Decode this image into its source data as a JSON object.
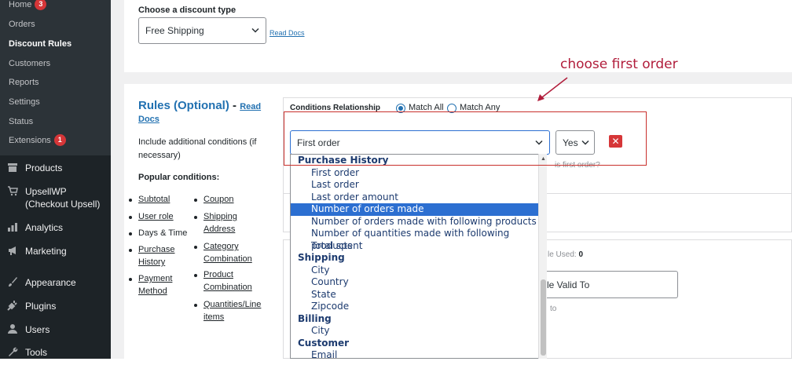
{
  "sidebar": {
    "submenu": [
      {
        "label": "Home",
        "badge": "3"
      },
      {
        "label": "Orders"
      },
      {
        "label": "Discount Rules"
      },
      {
        "label": "Customers"
      },
      {
        "label": "Reports"
      },
      {
        "label": "Settings"
      },
      {
        "label": "Status"
      },
      {
        "label": "Extensions",
        "badge": "1"
      }
    ],
    "menu": [
      {
        "label": "Products",
        "icon": "products-icon"
      },
      {
        "label": "UpsellWP\n(Checkout Upsell)",
        "icon": "cart-icon"
      },
      {
        "label": "Analytics",
        "icon": "analytics-icon"
      },
      {
        "label": "Marketing",
        "icon": "megaphone-icon"
      },
      {
        "label": "Appearance",
        "icon": "brush-icon"
      },
      {
        "label": "Plugins",
        "icon": "plugin-icon"
      },
      {
        "label": "Users",
        "icon": "user-icon"
      },
      {
        "label": "Tools",
        "icon": "wrench-icon"
      }
    ]
  },
  "discount_type": {
    "label": "Choose a discount type",
    "value": "Free Shipping",
    "read_docs": "Read Docs"
  },
  "annotation": "choose first order",
  "rules": {
    "title": "Rules (Optional)",
    "dash": " - ",
    "read": "Read",
    "docs": "Docs",
    "desc_1": "Include additional conditions (if",
    "desc_2": "necessary)",
    "popular": "Popular conditions:",
    "col1": [
      {
        "text": "Subtotal",
        "link": true
      },
      {
        "text": "User role",
        "link": true
      },
      {
        "text": "Days & Time",
        "link": false
      },
      {
        "text": "Purchase\nHistory",
        "link": true
      },
      {
        "text": "Payment\nMethod",
        "link": true
      }
    ],
    "col2": [
      {
        "text": "Coupon"
      },
      {
        "text": "Shipping\nAddress"
      },
      {
        "text": "Category\nCombination"
      },
      {
        "text": "Product\nCombination"
      },
      {
        "text": "Quantities/Line\nitems"
      }
    ]
  },
  "conditions": {
    "relationship_label": "Conditions Relationship",
    "match_all": "Match All",
    "match_any": "Match Any",
    "condition_value": "First order",
    "yes_value": "Yes",
    "remove": "✕",
    "hint": "is first order?"
  },
  "dropdown": [
    {
      "text": "Purchase History",
      "type": "group"
    },
    {
      "text": "First order",
      "type": "opt"
    },
    {
      "text": "Last order",
      "type": "opt"
    },
    {
      "text": "Last order amount",
      "type": "opt"
    },
    {
      "text": "Number of orders made",
      "type": "opt",
      "selected": true
    },
    {
      "text": "Number of orders made with following products",
      "type": "opt"
    },
    {
      "text": "Number of quantities made with following products",
      "type": "opt"
    },
    {
      "text": "Total spent",
      "type": "opt"
    },
    {
      "text": "Shipping",
      "type": "group"
    },
    {
      "text": "City",
      "type": "opt"
    },
    {
      "text": "Country",
      "type": "opt"
    },
    {
      "text": "State",
      "type": "opt"
    },
    {
      "text": "Zipcode",
      "type": "opt"
    },
    {
      "text": "Billing",
      "type": "group"
    },
    {
      "text": "City",
      "type": "opt"
    },
    {
      "text": "Customer",
      "type": "group"
    },
    {
      "text": "Email",
      "type": "opt"
    }
  ],
  "background": {
    "used_label": "le Used:",
    "used_value": "0",
    "valid_to": "le Valid To",
    "to_hint": "to"
  }
}
